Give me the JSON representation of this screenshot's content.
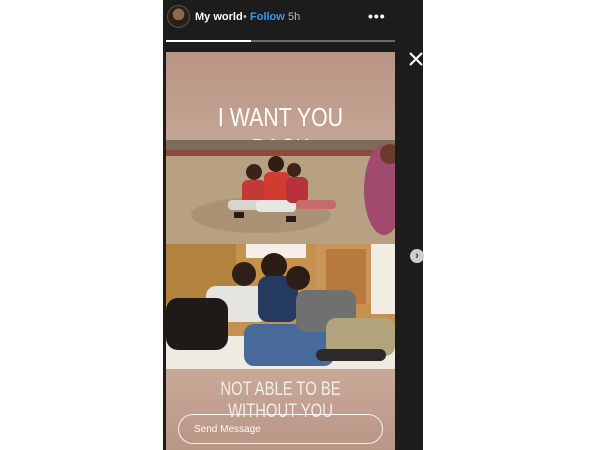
{
  "header": {
    "username": "My world",
    "separator": "•",
    "follow_label": "Follow",
    "time": "5h",
    "more_icon": "more-options-icon",
    "more_glyph": "•••"
  },
  "progress": {
    "segments": 2,
    "current_segment_fraction": 0.37
  },
  "story": {
    "caption_top": "I WANT YOU BACK",
    "caption_bottom": "NOT ABLE TO BE WITHOUT YOU"
  },
  "reply": {
    "placeholder": "Send Message"
  },
  "controls": {
    "close_icon": "close-icon",
    "next_icon": "chevron-right-icon",
    "next_glyph": "›"
  },
  "colors": {
    "background": "#1c1c1c",
    "follow": "#3897f0",
    "story_bg": "#c3a392"
  }
}
